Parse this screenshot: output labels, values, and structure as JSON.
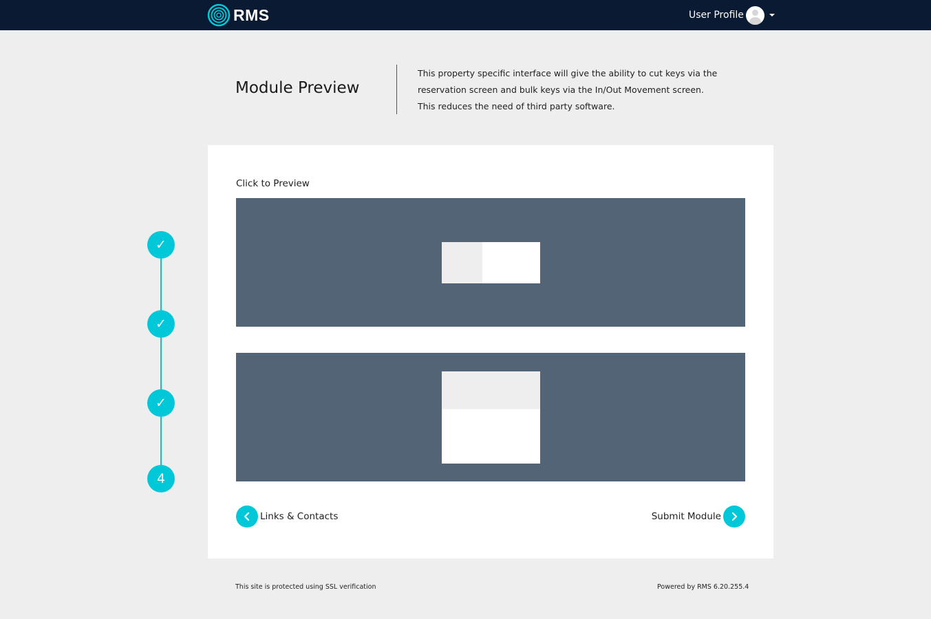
{
  "header": {
    "logo_text": "RMS",
    "user_profile_label": "User Profile"
  },
  "page": {
    "title": "Module Preview",
    "description": "This property specific interface will give the ability to cut keys via the reservation screen and bulk keys via the In/Out Movement screen. This reduces the need of third party software."
  },
  "card": {
    "click_label": "Click to Preview",
    "prev_label": "Links & Contacts",
    "next_label": "Submit Module"
  },
  "stepper": {
    "steps": [
      {
        "state": "complete",
        "glyph": "✓"
      },
      {
        "state": "complete",
        "glyph": "✓"
      },
      {
        "state": "complete",
        "glyph": "✓"
      },
      {
        "state": "current",
        "glyph": "4"
      }
    ]
  },
  "footer": {
    "ssl_text": "This site is protected using SSL verification",
    "powered_by": "Powered by RMS 6.20.255.4"
  },
  "colors": {
    "topbar": "#0a1a33",
    "accent": "#00c8d8",
    "preview_bg": "#526476",
    "page_bg": "#eeeeee"
  }
}
